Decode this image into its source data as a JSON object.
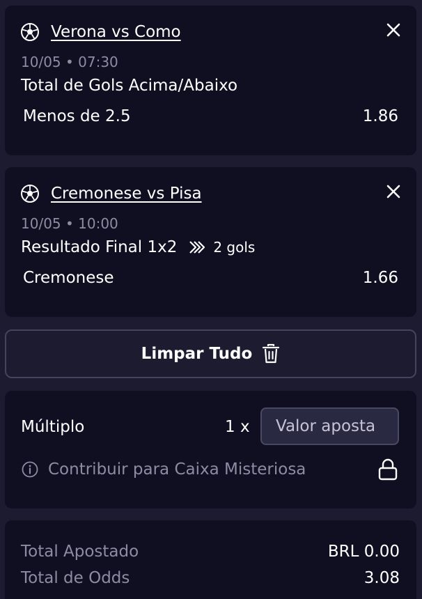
{
  "bets": [
    {
      "match": "Verona vs Como",
      "datetime": "10/05 • 07:30",
      "market": "Total de Gols Acima/Abaixo",
      "selection": "Menos de 2.5",
      "odd": "1.86"
    },
    {
      "match": "Cremonese vs Pisa",
      "datetime": "10/05 • 10:00",
      "market": "Resultado Final 1x2",
      "boost": "2 gols",
      "selection": "Cremonese",
      "odd": "1.66"
    }
  ],
  "clear_all": {
    "label": "Limpar Tudo"
  },
  "multiple": {
    "label": "Múltiplo",
    "multiplier": "1 x",
    "stake_placeholder": "Valor aposta",
    "stake_value": "",
    "mystery_box": "Contribuir para Caixa Misteriosa"
  },
  "totals": {
    "staked_label": "Total Apostado",
    "staked_value": "BRL 0.00",
    "odds_label": "Total de Odds",
    "odds_value": "3.08"
  },
  "icons": {
    "sport": "soccer-ball-icon",
    "remove": "close-icon",
    "boost": "double-chevron-icon",
    "clear": "trash-icon",
    "info": "info-icon",
    "lock": "lock-icon"
  },
  "colors": {
    "page_bg": "#1c1b30",
    "card_bg": "#100f22",
    "muted_text": "#8d8ca3",
    "input_bg": "#2a2942",
    "border": "#45445e"
  }
}
